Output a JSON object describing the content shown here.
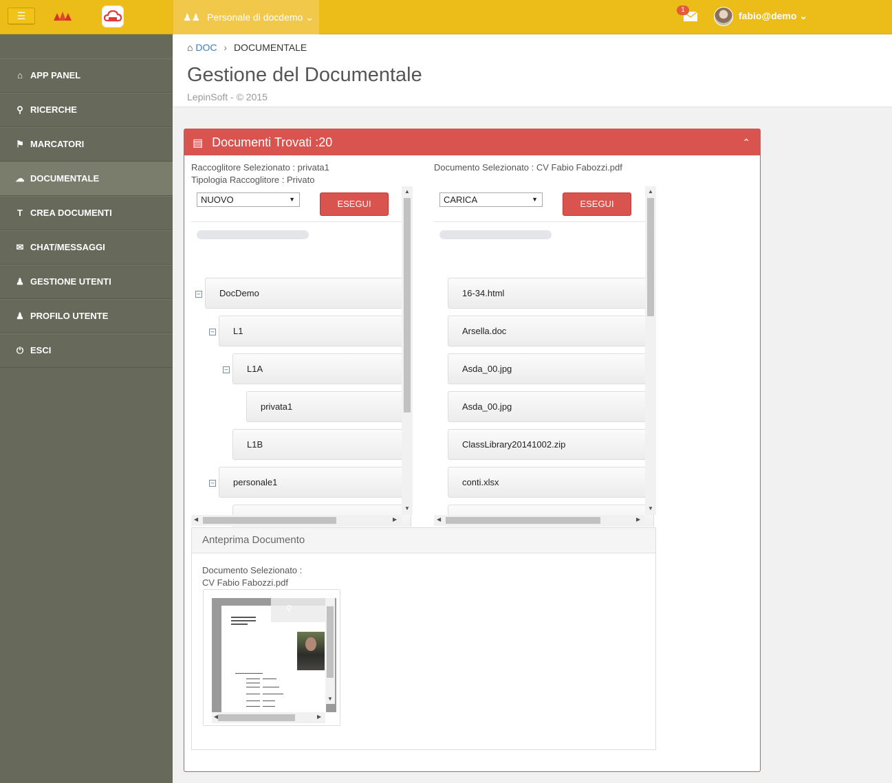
{
  "topbar": {
    "menu_icon": "hamburger-icon",
    "org_label": "Personale di docdemo",
    "notifications": "1",
    "user": "fabio@demo"
  },
  "sidebar": {
    "items": [
      {
        "label": "APP PANEL",
        "icon": "home-icon"
      },
      {
        "label": "RICERCHE",
        "icon": "search-icon"
      },
      {
        "label": "MARCATORI",
        "icon": "tags-icon"
      },
      {
        "label": "DOCUMENTALE",
        "icon": "cloud-upload-icon",
        "active": true
      },
      {
        "label": "CREA DOCUMENTI",
        "icon": "text-icon"
      },
      {
        "label": "CHAT/MESSAGGI",
        "icon": "envelope-icon"
      },
      {
        "label": "GESTIONE UTENTI",
        "icon": "users-icon"
      },
      {
        "label": "PROFILO UTENTE",
        "icon": "user-icon"
      },
      {
        "label": "ESCI",
        "icon": "power-icon"
      }
    ]
  },
  "breadcrumb": {
    "root": "DOC",
    "current": "DOCUMENTALE"
  },
  "page": {
    "title": "Gestione del Documentale",
    "subtitle": "LepinSoft - © 2015"
  },
  "panel": {
    "title": "Documenti Trovati :20",
    "left": {
      "info1": "Raccoglitore Selezionato : privata1",
      "info2": "Tipologia Raccoglitore : Privato",
      "select": "NUOVO",
      "button": "ESEGUI",
      "tree": [
        {
          "label": "DocDemo",
          "level": 0,
          "toggle": true
        },
        {
          "label": "L1",
          "level": 1,
          "toggle": true
        },
        {
          "label": "L1A",
          "level": 2,
          "toggle": true
        },
        {
          "label": "privata1",
          "level": 3,
          "toggle": false
        },
        {
          "label": "L1B",
          "level": 2,
          "toggle": false
        },
        {
          "label": "personale1",
          "level": 1,
          "toggle": true
        }
      ]
    },
    "right": {
      "info1": "Documento Selezionato : CV Fabio Fabozzi.pdf",
      "select": "CARICA",
      "button": "ESEGUI",
      "files": [
        "16-34.html",
        "Arsella.doc",
        "Asda_00.jpg",
        "Asda_00.jpg",
        "ClassLibrary20141002.zip",
        "conti.xlsx"
      ]
    }
  },
  "preview": {
    "title": "Anteprima Documento",
    "label": "Documento Selezionato :",
    "filename": "CV Fabio Fabozzi.pdf"
  },
  "colors": {
    "topbar": "#ecbd18",
    "sidebar": "#67695a",
    "accent": "#d9534f"
  }
}
